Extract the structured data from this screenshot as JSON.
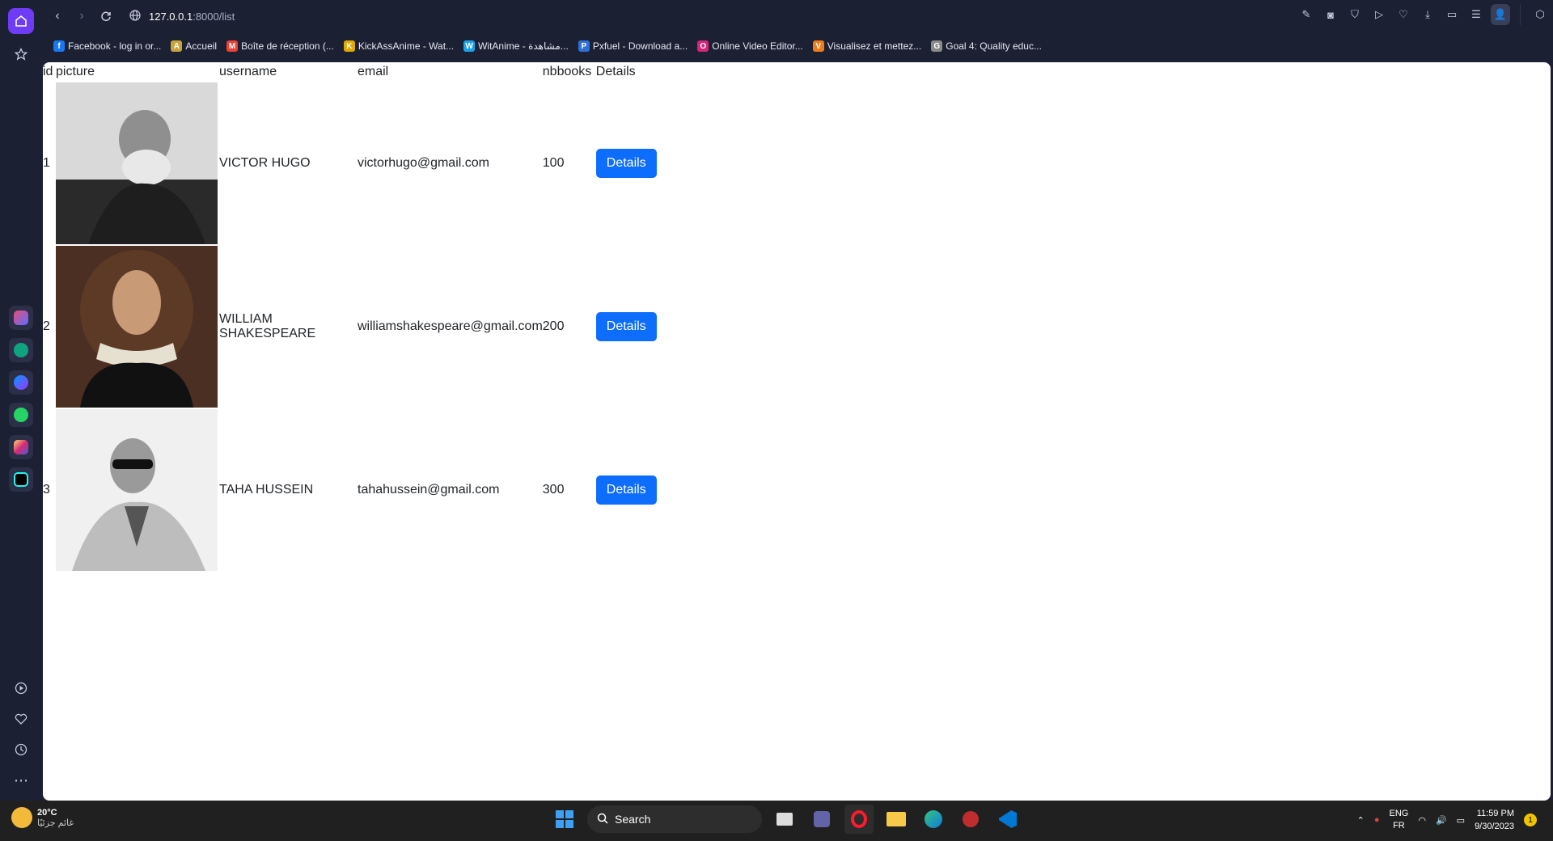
{
  "browser": {
    "url_host": "127.0.0.1",
    "url_path": ":8000/list",
    "accent": "#6f3cf6"
  },
  "bookmarks": [
    {
      "label": "Facebook - log in or...",
      "icon": "facebook-icon",
      "color": "#1877f2",
      "glyph": "f"
    },
    {
      "label": "Accueil",
      "icon": "accueil-icon",
      "color": "#c8a43a",
      "glyph": "A"
    },
    {
      "label": "Boîte de réception (...",
      "icon": "gmail-icon",
      "color": "#ea4335",
      "glyph": "M"
    },
    {
      "label": "KickAssAnime - Wat...",
      "icon": "kickassanime-icon",
      "color": "#e0a800",
      "glyph": "K"
    },
    {
      "label": "WitAnime - مشاهدة...",
      "icon": "witanime-icon",
      "color": "#1aa3e8",
      "glyph": "W"
    },
    {
      "label": "Pxfuel - Download a...",
      "icon": "pxfuel-icon",
      "color": "#2f6fd6",
      "glyph": "P"
    },
    {
      "label": "Online Video Editor...",
      "icon": "video-editor-icon",
      "color": "#d6267a",
      "glyph": "O"
    },
    {
      "label": "Visualisez et mettez...",
      "icon": "visualisez-icon",
      "color": "#f07b19",
      "glyph": "V"
    },
    {
      "label": "Goal 4: Quality educ...",
      "icon": "goal4-icon",
      "color": "#8a8a8a",
      "glyph": "G"
    }
  ],
  "table": {
    "headers": {
      "id": "id",
      "picture": "picture",
      "username": "username",
      "email": "email",
      "nbbooks": "nbbooks",
      "details": "Details"
    },
    "rows": [
      {
        "id": "1",
        "username": "VICTOR HUGO",
        "email": "victorhugo@gmail.com",
        "nbbooks": "100",
        "button": "Details",
        "picture_icon": "victor-hugo-portrait"
      },
      {
        "id": "2",
        "username": "WILLIAM SHAKESPEARE",
        "email": "williamshakespeare@gmail.com",
        "nbbooks": "200",
        "button": "Details",
        "picture_icon": "shakespeare-portrait"
      },
      {
        "id": "3",
        "username": "TAHA HUSSEIN",
        "email": "tahahussein@gmail.com",
        "nbbooks": "300",
        "button": "Details",
        "picture_icon": "taha-hussein-portrait"
      }
    ],
    "button_color": "#0d6efd"
  },
  "taskbar": {
    "temperature": "20°C",
    "weather_text": "غائم جزئيًا",
    "search_label": "Search",
    "lang_top": "ENG",
    "lang_bottom": "FR",
    "time": "11:59 PM",
    "date": "9/30/2023",
    "notification_count": "1"
  }
}
